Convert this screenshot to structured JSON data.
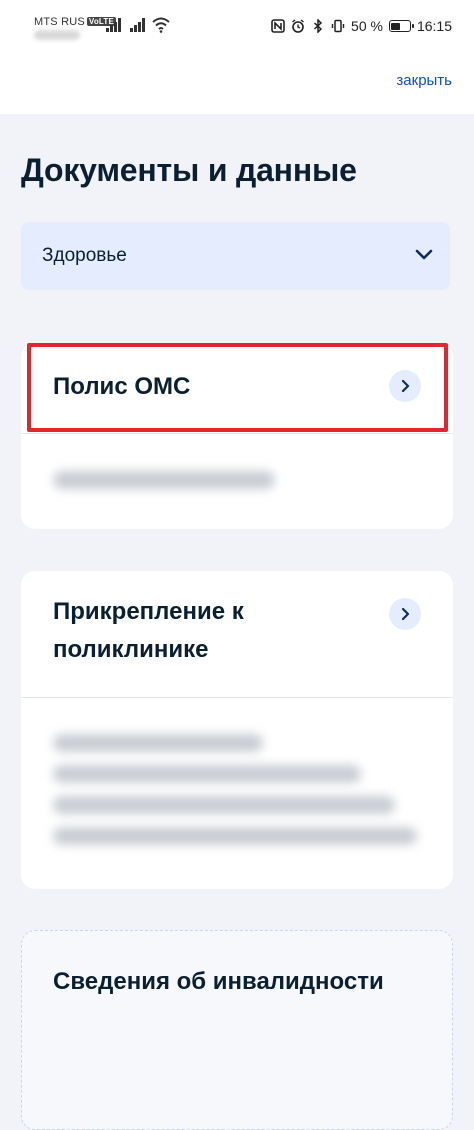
{
  "status_bar": {
    "carrier": "MTS RUS",
    "volte": "VoLTE",
    "battery": "50 %",
    "time": "16:15"
  },
  "header": {
    "close_label": "закрыть"
  },
  "page": {
    "title": "Документы и данные"
  },
  "category_select": {
    "value": "Здоровье"
  },
  "cards": [
    {
      "title": "Полис ОМС"
    },
    {
      "title_line1": "Прикрепление к",
      "title_line2": "поликлинике"
    },
    {
      "title": "Сведения об инвалидности"
    }
  ],
  "colors": {
    "accent": "#0d4cd3",
    "highlight": "#e3262c",
    "select_bg": "#e4ecfd",
    "page_bg": "#f1f3f8"
  }
}
